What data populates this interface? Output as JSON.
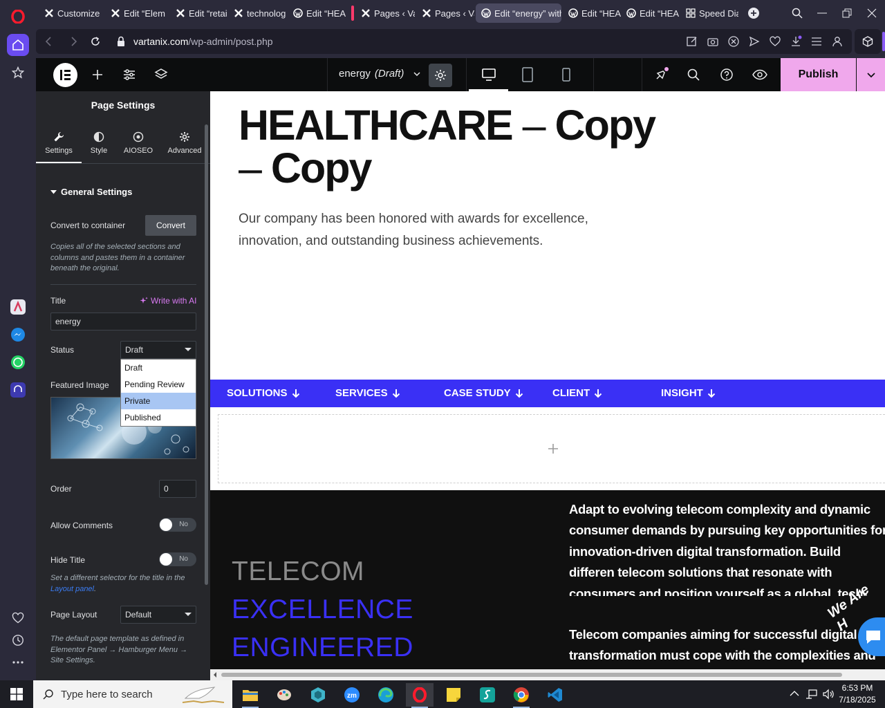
{
  "browser": {
    "tabs": [
      {
        "label": "Customize",
        "icon": "elementor-x-icon"
      },
      {
        "label": "Edit “Elem",
        "icon": "elementor-x-icon"
      },
      {
        "label": "Edit “retai",
        "icon": "elementor-x-icon"
      },
      {
        "label": "technolog",
        "icon": "elementor-x-icon"
      },
      {
        "label": "Edit “HEAL",
        "icon": "wordpress-icon"
      },
      {
        "label": "Pages ‹ Va",
        "icon": "elementor-x-icon"
      },
      {
        "label": "Pages ‹ Va",
        "icon": "elementor-x-icon"
      },
      {
        "label": "Edit “energy” with",
        "icon": "wordpress-icon"
      },
      {
        "label": "Edit “HEAL",
        "icon": "wordpress-icon"
      },
      {
        "label": "Edit “HEAL",
        "icon": "wordpress-icon"
      },
      {
        "label": "Speed Dia",
        "icon": "speed-dial-icon"
      }
    ],
    "url_domain": "vartanix.com",
    "url_path": "/wp-admin/post.php"
  },
  "elementor": {
    "doc_title": "energy",
    "doc_status": "(Draft)",
    "publish_label": "Publish"
  },
  "panel": {
    "title": "Page Settings",
    "tabs": [
      "Settings",
      "Style",
      "AIOSEO",
      "Advanced"
    ],
    "section_title": "General Settings",
    "convert_label": "Convert to container",
    "convert_button": "Convert",
    "convert_help": "Copies all of the selected sections and columns and pastes them in a container beneath the original.",
    "title_label": "Title",
    "write_ai": "Write with AI",
    "title_value": "energy",
    "status_label": "Status",
    "status_value": "Draft",
    "status_options": [
      "Draft",
      "Pending Review",
      "Private",
      "Published"
    ],
    "featured_label": "Featured Image",
    "order_label": "Order",
    "order_value": "0",
    "allow_comments_label": "Allow Comments",
    "allow_comments_value": "No",
    "hide_title_label": "Hide Title",
    "hide_title_value": "No",
    "hide_title_help": "Set a different selector for the title in the",
    "hide_title_link": "Layout panel",
    "page_layout_label": "Page Layout",
    "page_layout_value": "Default",
    "page_layout_help": "The default page template as defined in Elementor Panel → Hamburger Menu → Site Settings."
  },
  "canvas": {
    "heading_1": "HEALTHCARE",
    "heading_dash": "–",
    "heading_copy": "Copy",
    "subtext": "Our company has been honored with awards for excellence, innovation, and outstanding business achievements.",
    "menu": [
      "SOLUTIONS",
      "SERVICES",
      "CASE STUDY",
      "CLIENT",
      "INSIGHT"
    ],
    "telecom_1": "TELECOM",
    "telecom_2": "EXCELLENCE",
    "telecom_3": "ENGINEERED",
    "para_1": "Adapt to evolving telecom complexity and dynamic consumer demands by pursuing key opportunities for innovation-driven digital transformation. Build differen telecom solutions that resonate with consumers and position yourself as a global, tech-forward telecom lea",
    "para_2": "Telecom companies aiming for successful digital transformation must cope with the complexities and",
    "chat_badge": "We Are H"
  },
  "taskbar": {
    "search_placeholder": "Type here to search",
    "time": "6:53 PM",
    "date": "7/18/2025"
  },
  "colors": {
    "accent_blue": "#3a30f5",
    "publish_pink": "#f0a8ec",
    "opera_red": "#ff1b2d"
  }
}
